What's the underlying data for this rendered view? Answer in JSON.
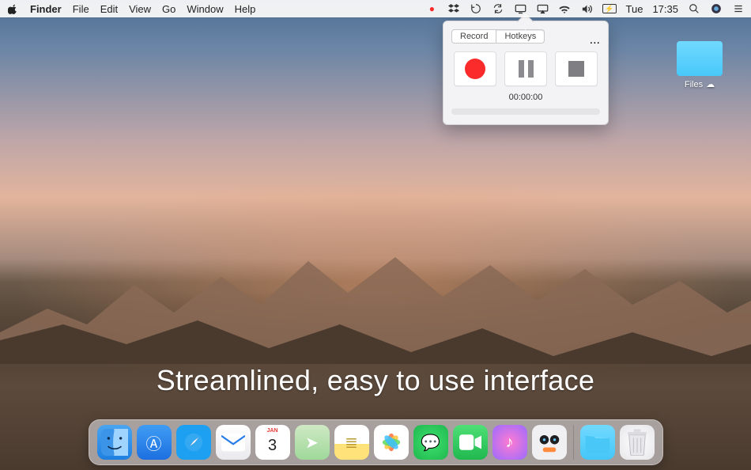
{
  "menubar": {
    "app": "Finder",
    "items": [
      "File",
      "Edit",
      "View",
      "Go",
      "Window",
      "Help"
    ],
    "status": {
      "record_dot": "●",
      "dropbox": "dropbox-icon",
      "timemachine": "circle-arrow-icon",
      "sync": "sync-icon",
      "screen": "screen-share-icon",
      "airplay": "airplay-icon",
      "wifi": "wifi-icon",
      "volume": "volume-icon",
      "battery": "battery-icon",
      "battery_text": "⚡",
      "day": "Tue",
      "time": "17:35",
      "spotlight": "search-icon",
      "siri": "siri-icon",
      "notifications": "list-icon"
    }
  },
  "desktop_folder": {
    "label": "Files",
    "cloud": "☁"
  },
  "panel": {
    "tabs": {
      "record": "Record",
      "hotkeys": "Hotkeys",
      "more": "..."
    },
    "active_tab": "Hotkeys",
    "timer": "00:00:00"
  },
  "overlay_text": "Streamlined, easy to use interface",
  "dock": {
    "apps": [
      {
        "id": "finder",
        "label": "Finder"
      },
      {
        "id": "appstore",
        "label": "App Store",
        "glyph": "Ⓐ"
      },
      {
        "id": "safari",
        "label": "Safari",
        "glyph": "✦"
      },
      {
        "id": "mail",
        "label": "Mail",
        "glyph": "✉"
      },
      {
        "id": "calendar",
        "label": "Calendar",
        "month": "JAN",
        "day": "3"
      },
      {
        "id": "maps",
        "label": "Maps",
        "glyph": "➤"
      },
      {
        "id": "notes",
        "label": "Notes",
        "glyph": "≣"
      },
      {
        "id": "photos",
        "label": "Photos",
        "glyph": "✿"
      },
      {
        "id": "messages",
        "label": "Messages",
        "glyph": "💬"
      },
      {
        "id": "facetime",
        "label": "FaceTime",
        "glyph": "▣"
      },
      {
        "id": "itunes",
        "label": "iTunes",
        "glyph": "♪"
      },
      {
        "id": "rec",
        "label": "Recorder"
      }
    ],
    "right": [
      {
        "id": "folder",
        "label": "Downloads"
      },
      {
        "id": "trash",
        "label": "Trash",
        "glyph": "🗑"
      }
    ]
  }
}
